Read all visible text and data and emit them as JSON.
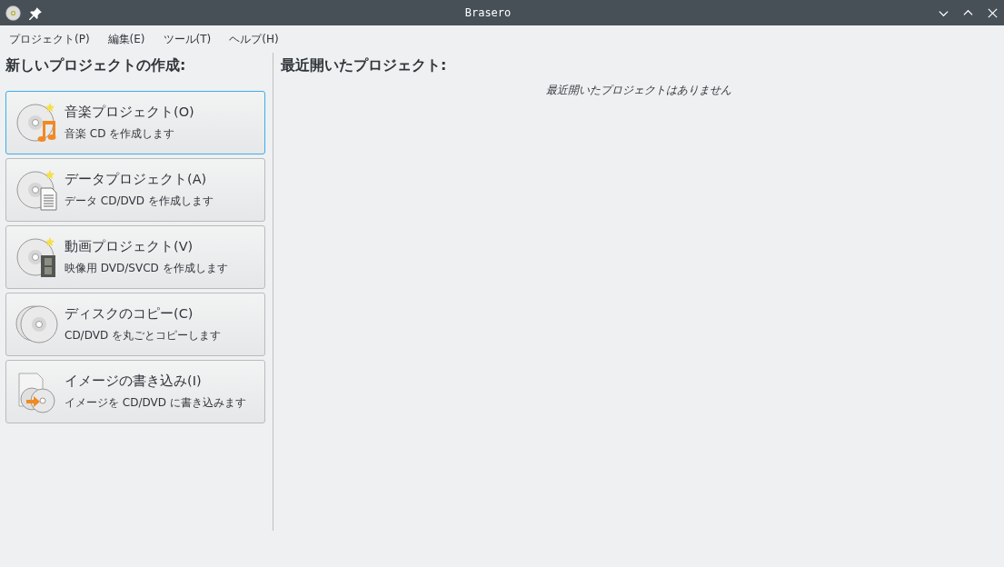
{
  "window": {
    "title": "Brasero"
  },
  "menu": [
    "プロジェクト(P)",
    "編集(E)",
    "ツール(T)",
    "ヘルプ(H)"
  ],
  "new_project": {
    "heading": "新しいプロジェクトの作成:",
    "buttons": [
      {
        "kind": "audio",
        "title": "音楽プロジェクト(O)",
        "subtitle": "音楽 CD を作成します",
        "selected": true
      },
      {
        "kind": "data",
        "title": "データプロジェクト(A)",
        "subtitle": "データ CD/DVD を作成します",
        "selected": false
      },
      {
        "kind": "video",
        "title": "動画プロジェクト(V)",
        "subtitle": "映像用 DVD/SVCD を作成します",
        "selected": false
      },
      {
        "kind": "copy",
        "title": "ディスクのコピー(C)",
        "subtitle": "CD/DVD を丸ごとコピーします",
        "selected": false
      },
      {
        "kind": "image",
        "title": "イメージの書き込み(I)",
        "subtitle": "イメージを CD/DVD に書き込みます",
        "selected": false
      }
    ]
  },
  "recent": {
    "heading": "最近開いたプロジェクト:",
    "empty_message": "最近開いたプロジェクトはありません"
  }
}
